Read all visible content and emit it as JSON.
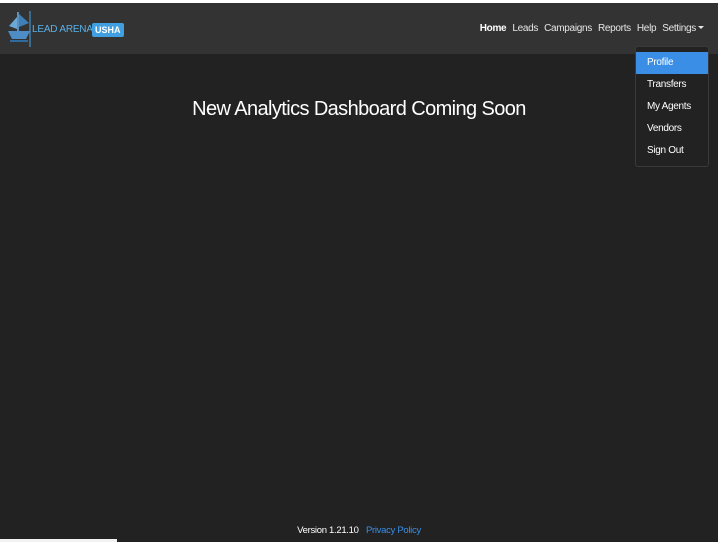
{
  "brand": {
    "name": "LEAD ARENA",
    "badge": "USHA",
    "logo_icon": "ship-logo-icon"
  },
  "nav": {
    "items": [
      {
        "label": "Home",
        "active": true
      },
      {
        "label": "Leads",
        "active": false
      },
      {
        "label": "Campaigns",
        "active": false
      },
      {
        "label": "Reports",
        "active": false
      },
      {
        "label": "Help",
        "active": false
      },
      {
        "label": "Settings",
        "active": false,
        "dropdown_open": true
      }
    ]
  },
  "settings_menu": {
    "items": [
      {
        "label": "Profile",
        "active": true
      },
      {
        "label": "Transfers",
        "active": false
      },
      {
        "label": "My Agents",
        "active": false
      },
      {
        "label": "Vendors",
        "active": false
      },
      {
        "label": "Sign Out",
        "active": false
      }
    ]
  },
  "main": {
    "headline": "New Analytics Dashboard Coming Soon"
  },
  "footer": {
    "version": "Version 1.21.10",
    "privacy_link": "Privacy Policy"
  },
  "colors": {
    "background": "#222222",
    "navbar": "#333333",
    "accent": "#3a8ee6",
    "badge": "#3f9fe0"
  }
}
